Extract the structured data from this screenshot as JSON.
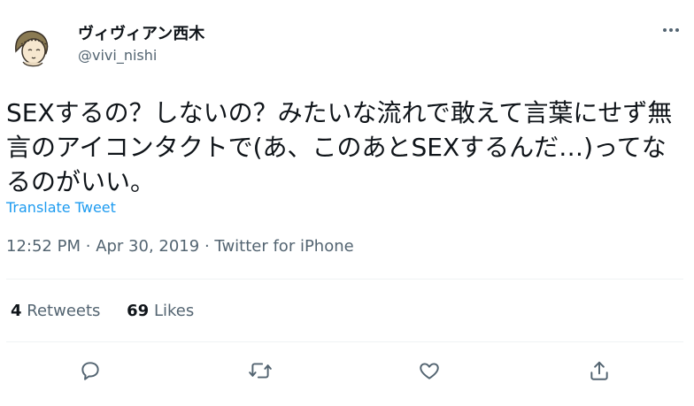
{
  "user": {
    "display_name": "ヴィヴィアン西木",
    "handle": "@vivi_nishi"
  },
  "tweet": {
    "text": "SEXするの？しないの？みたいな流れで敢えて言葉にせず無言のアイコンタクトで(あ、このあとSEXするんだ…)ってなるのがいい。",
    "translate_label": "Translate Tweet",
    "time": "12:52 PM",
    "date": "Apr 30, 2019",
    "source": "Twitter for iPhone",
    "separator": "·"
  },
  "stats": {
    "retweets_count": "4",
    "retweets_label": "Retweets",
    "likes_count": "69",
    "likes_label": "Likes"
  },
  "icons": [
    "avatar",
    "more-icon",
    "reply-icon",
    "retweet-icon",
    "like-icon",
    "share-icon"
  ],
  "colors": {
    "text": "#0f1419",
    "secondary": "#536471",
    "link": "#1d9bf0",
    "divider": "#eff3f4"
  }
}
